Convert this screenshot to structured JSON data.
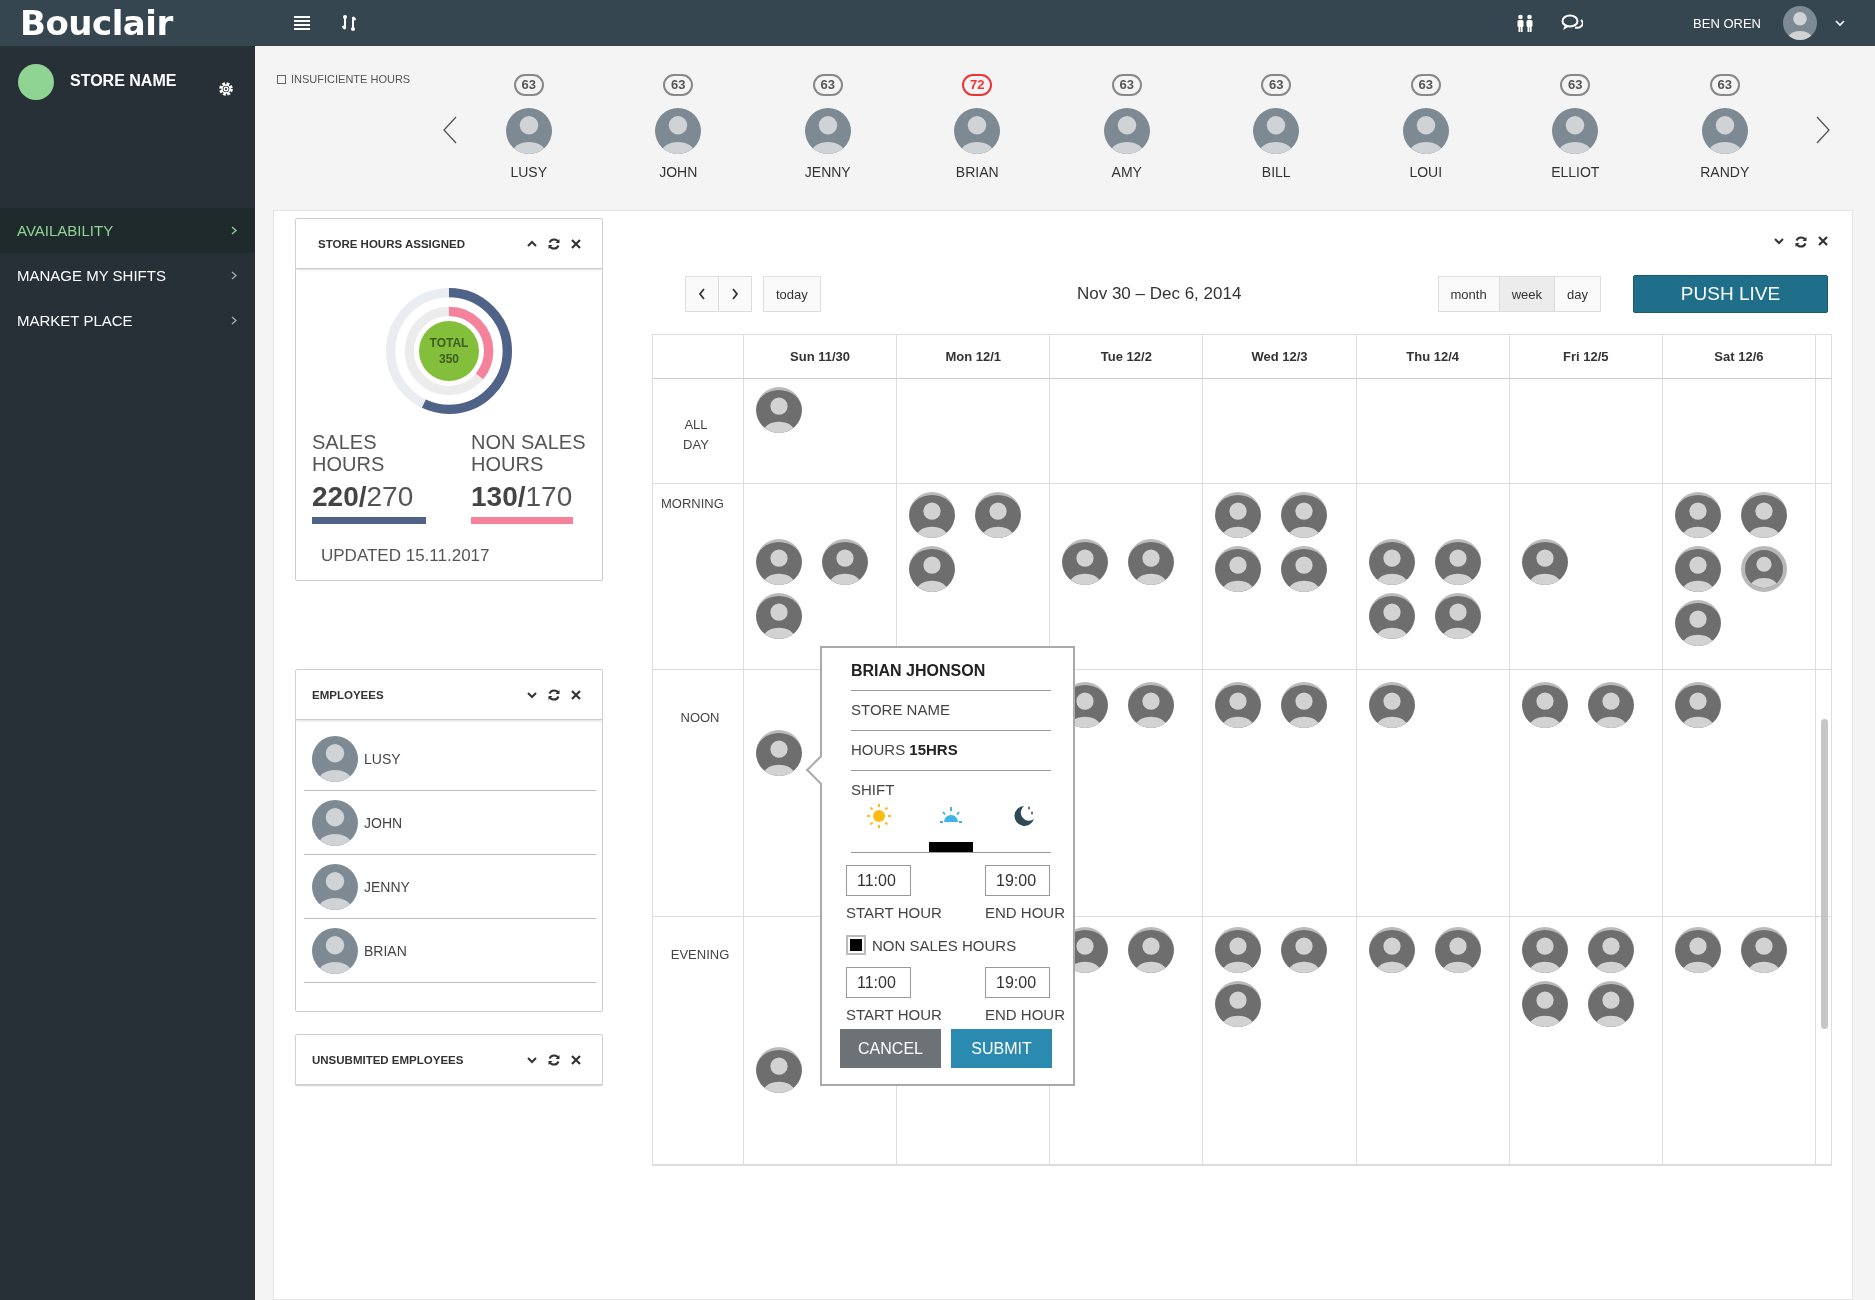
{
  "topbar": {
    "logo": "Bouclair",
    "user_name": "BEN OREN"
  },
  "sidebar": {
    "store_name": "STORE NAME",
    "items": [
      {
        "label": "AVAILABILITY",
        "selected": true
      },
      {
        "label": "MANAGE MY SHIFTS",
        "selected": false
      },
      {
        "label": "MARKET PLACE",
        "selected": false
      }
    ]
  },
  "hours_filter": {
    "label": "INSUFICIENTE HOURS",
    "checked": false
  },
  "employee_strip": [
    {
      "name": "LUSY",
      "hours": "63",
      "alert": false
    },
    {
      "name": "JOHN",
      "hours": "63",
      "alert": false
    },
    {
      "name": "JENNY",
      "hours": "63",
      "alert": false
    },
    {
      "name": "BRIAN",
      "hours": "72",
      "alert": true
    },
    {
      "name": "AMY",
      "hours": "63",
      "alert": false
    },
    {
      "name": "BILL",
      "hours": "63",
      "alert": false
    },
    {
      "name": "LOUI",
      "hours": "63",
      "alert": false
    },
    {
      "name": "ELLIOT",
      "hours": "63",
      "alert": false
    },
    {
      "name": "RANDY",
      "hours": "63",
      "alert": false
    }
  ],
  "store_hours": {
    "title": "STORE HOURS ASSIGNED",
    "total_label": "TOTAL",
    "total": "350",
    "sales_ring": {
      "level": 0.57
    },
    "non_sales_ring": {
      "level": 0.36
    },
    "sales_label": "SALES HOURS",
    "sales_done": "220/",
    "sales_total": "270",
    "non_sales_label": "NON SALES HOURS",
    "non_sales_done": "130/",
    "non_sales_total": "170",
    "updated": "UPDATED 15.11.2017"
  },
  "employees": {
    "title": "EMPLOYEES",
    "items": [
      {
        "name": "LUSY"
      },
      {
        "name": "JOHN"
      },
      {
        "name": "JENNY"
      },
      {
        "name": "BRIAN"
      }
    ]
  },
  "unsubmitted": {
    "title": "UNSUBMITED EMPLOYEES"
  },
  "calendar": {
    "today": "today",
    "title": "Nov 30 – Dec 6, 2014",
    "views": [
      {
        "label": "month",
        "selected": false
      },
      {
        "label": "week",
        "selected": true
      },
      {
        "label": "day",
        "selected": false
      }
    ],
    "push_live": "PUSH LIVE",
    "days": [
      "Sun 11/30",
      "Mon 12/1",
      "Tue 12/2",
      "Wed 12/3",
      "Thu 12/4",
      "Fri 12/5",
      "Sat 12/6"
    ],
    "slots": [
      {
        "label": "ALL DAY",
        "cells": [
          {
            "avatars": [
              {
                "highlighted": false
              }
            ]
          },
          {},
          {},
          {},
          {},
          {},
          {}
        ]
      },
      {
        "label": "MORNING",
        "cells": [
          {
            "avatars": [
              {
                "highlighted": false
              },
              {
                "highlighted": false
              },
              {
                "highlighted": false
              }
            ]
          },
          {
            "avatars": [
              {
                "highlighted": false
              },
              {
                "highlighted": false
              },
              {
                "highlighted": false
              }
            ]
          },
          {
            "avatars": [
              {
                "highlighted": false
              },
              {
                "highlighted": false
              }
            ]
          },
          {
            "avatars": [
              {
                "highlighted": false
              },
              {
                "highlighted": false
              },
              {
                "highlighted": false
              },
              {
                "highlighted": false
              }
            ]
          },
          {
            "avatars": [
              {
                "highlighted": false
              },
              {
                "highlighted": false
              },
              {
                "highlighted": false
              },
              {
                "highlighted": false
              }
            ]
          },
          {
            "avatars": [
              {
                "highlighted": false
              }
            ]
          },
          {
            "avatars": [
              {
                "highlighted": false
              },
              {
                "highlighted": false
              },
              {
                "highlighted": false
              },
              {
                "highlighted": true
              },
              {
                "highlighted": false
              }
            ]
          }
        ]
      },
      {
        "label": "NOON",
        "cells": [
          {
            "avatars": [
              {
                "highlighted": false
              }
            ]
          },
          {},
          {
            "avatars": [
              {
                "highlighted": false
              },
              {
                "highlighted": false
              }
            ]
          },
          {
            "avatars": [
              {
                "highlighted": false
              },
              {
                "highlighted": false
              }
            ]
          },
          {
            "avatars": [
              {
                "highlighted": false
              }
            ]
          },
          {
            "avatars": [
              {
                "highlighted": false
              },
              {
                "highlighted": false
              }
            ]
          },
          {
            "avatars": [
              {
                "highlighted": false
              }
            ]
          }
        ]
      },
      {
        "label": "EVENING",
        "cells": [
          {
            "avatars": [
              {
                "highlighted": false
              }
            ]
          },
          {},
          {
            "avatars": [
              {
                "highlighted": false
              },
              {
                "highlighted": false
              }
            ]
          },
          {
            "avatars": [
              {
                "highlighted": false
              },
              {
                "highlighted": false
              },
              {
                "highlighted": false
              }
            ]
          },
          {
            "avatars": [
              {
                "highlighted": false
              },
              {
                "highlighted": false
              }
            ]
          },
          {
            "avatars": [
              {
                "highlighted": false
              },
              {
                "highlighted": false
              },
              {
                "highlighted": false
              },
              {
                "highlighted": false
              }
            ]
          },
          {
            "avatars": [
              {
                "highlighted": false
              },
              {
                "highlighted": false
              }
            ]
          }
        ]
      }
    ]
  },
  "popup": {
    "name": "BRIAN JHONSON",
    "store": "STORE NAME",
    "hours": "HOURS **15HRS**",
    "shift_label": "SHIFT",
    "shifts": [
      {
        "kind": "sun",
        "selected": false
      },
      {
        "kind": "sunrise",
        "selected": true
      },
      {
        "kind": "moon",
        "selected": false
      }
    ],
    "start": "11:00",
    "start_label": "START HOUR",
    "end": "19:00",
    "end_label": "END HOUR",
    "non_sales": {
      "label": "NON SALES HOURS",
      "checked": true
    },
    "ns_start": "11:00",
    "ns_start_label": "START HOUR",
    "ns_end": "19:00",
    "ns_end_label": "END HOUR",
    "cancel": "CANCEL",
    "submit": "SUBMIT"
  }
}
